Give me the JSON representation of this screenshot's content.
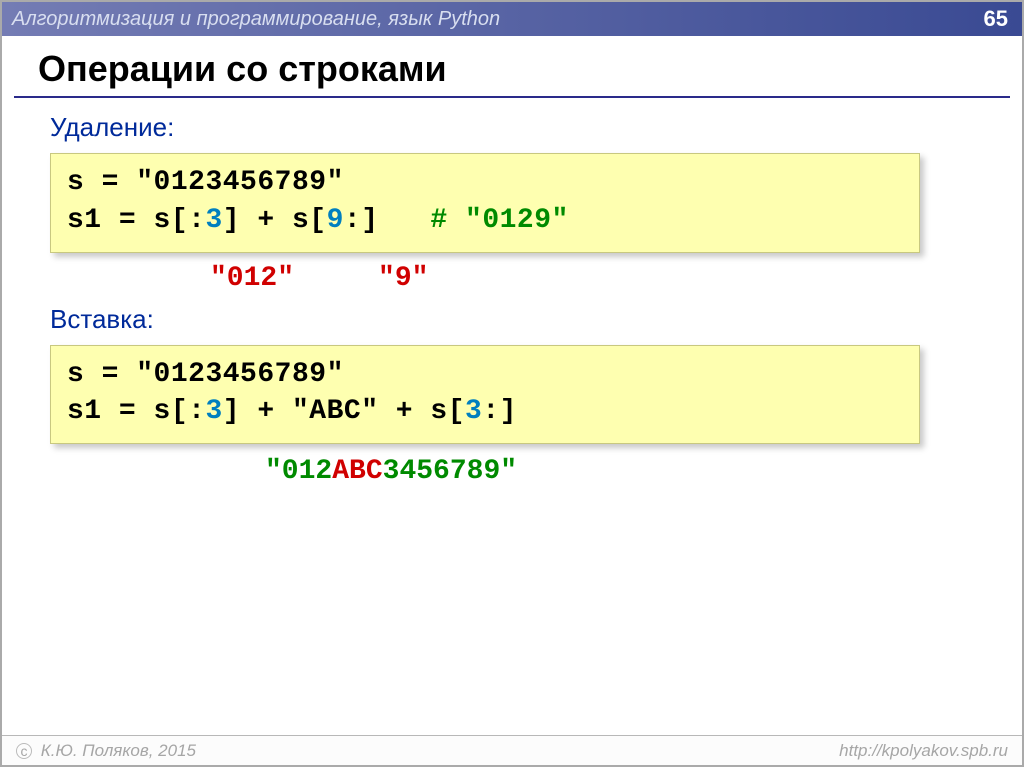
{
  "header": {
    "title": "Алгоритмизация и программирование, язык Python",
    "page": "65"
  },
  "mainTitle": "Операции со строками",
  "deletion": {
    "label": "Удаление:",
    "line1_s": "s",
    "line1_eq": " = ",
    "line1_str": "\"0123456789\"",
    "line2_s1": "s1",
    "line2_eq": " = ",
    "line2_a": "s[:",
    "line2_n1": "3",
    "line2_b": "] + s[",
    "line2_n2": "9",
    "line2_c": ":]   ",
    "line2_cmt": "# \"0129\"",
    "hintLeft": "\"012\"",
    "hintRight": "\"9\""
  },
  "insertion": {
    "label": "Вставка:",
    "line1_s": "s",
    "line1_eq": " = ",
    "line1_str": "\"0123456789\"",
    "line2_s1": "s1",
    "line2_eq": " = ",
    "line2_a": "s[:",
    "line2_n1": "3",
    "line2_b": "] + \"ABC\" + s[",
    "line2_n2": "3",
    "line2_c": ":]",
    "resultPre": "\"012",
    "resultMid": "ABC",
    "resultPost": "3456789\""
  },
  "footer": {
    "copyright": " К.Ю. Поляков, 2015",
    "url": "http://kpolyakov.spb.ru"
  }
}
